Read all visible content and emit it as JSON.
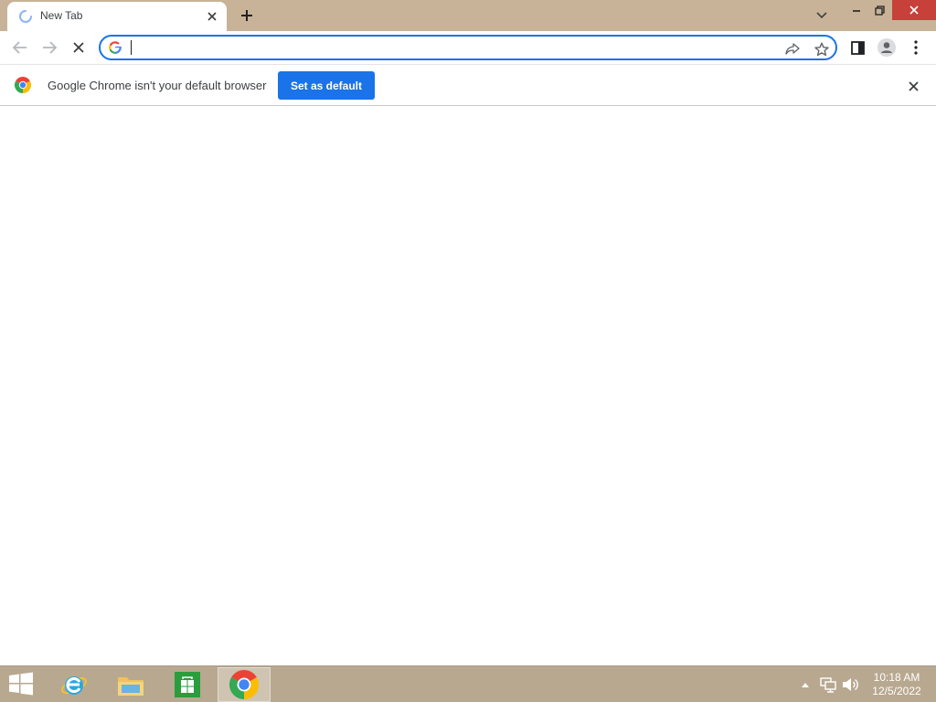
{
  "browser": {
    "tab": {
      "title": "New Tab",
      "loading": true
    },
    "omnibox": {
      "value": "",
      "placeholder": ""
    },
    "infobar": {
      "message": "Google Chrome isn't your default browser",
      "button_label": "Set as default"
    },
    "icons": [
      "loading-spinner-icon",
      "close-icon",
      "plus-icon",
      "chevron-down-icon",
      "minimize-icon",
      "restore-icon",
      "back-arrow-icon",
      "forward-arrow-icon",
      "stop-icon",
      "google-g-icon",
      "share-icon",
      "star-icon",
      "side-panel-icon",
      "profile-icon",
      "more-menu-icon",
      "chrome-logo-icon"
    ],
    "colors": {
      "accent": "#1a73e8",
      "frame": "#c8b398",
      "close_button": "#c7403a"
    }
  },
  "taskbar": {
    "apps": [
      "Internet Explorer",
      "File Explorer",
      "Store",
      "Google Chrome"
    ],
    "active_app": "Google Chrome",
    "clock": {
      "time": "10:18 AM",
      "date": "12/5/2022"
    }
  }
}
